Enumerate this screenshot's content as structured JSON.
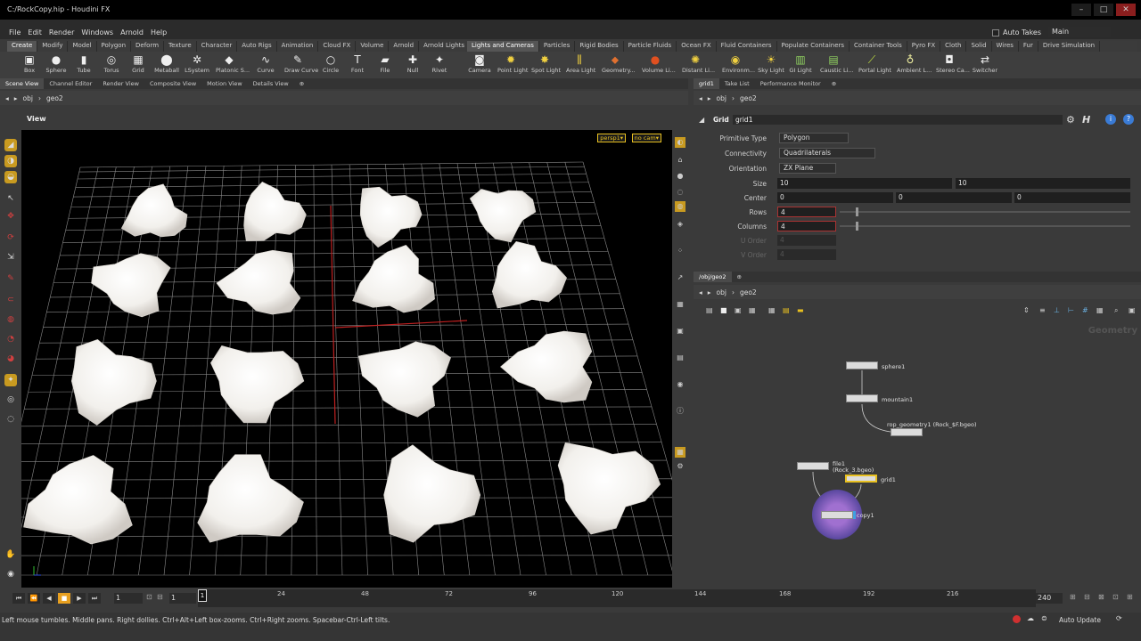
{
  "window": {
    "title": "C:/RockCopy.hip - Houdini FX",
    "buttons": [
      "–",
      "□",
      "✕"
    ]
  },
  "menubar": {
    "items": [
      "File",
      "Edit",
      "Render",
      "Windows",
      "Arnold",
      "Help"
    ],
    "auto_takes": "Auto Takes",
    "desktop": "Main"
  },
  "shelf_left_tabs": [
    "Create",
    "Modify",
    "Model",
    "Polygon",
    "Deform",
    "Texture",
    "Character",
    "Auto Rigs",
    "Animation",
    "Cloud FX",
    "Volume",
    "Arnold",
    "Arnold Lights"
  ],
  "shelf_right_tabs": [
    "Lights and Cameras",
    "Particles",
    "Rigid Bodies",
    "Particle Fluids",
    "Ocean FX",
    "Fluid Containers",
    "Populate Containers",
    "Container Tools",
    "Pyro FX",
    "Cloth",
    "Solid",
    "Wires",
    "Fur",
    "Drive Simulation"
  ],
  "shelf_left_tools": [
    "Box",
    "Sphere",
    "Tube",
    "Torus",
    "Grid",
    "Metaball",
    "LSystem",
    "Platonic S...",
    "Curve",
    "Draw Curve",
    "Circle",
    "Font",
    "File",
    "Null",
    "Rivet"
  ],
  "shelf_right_tools": [
    "Camera",
    "Point Light",
    "Spot Light",
    "Area Light",
    "Geometry...",
    "Volume Li...",
    "Distant Li...",
    "Environm...",
    "Sky Light",
    "GI Light",
    "Caustic Li...",
    "Portal Light",
    "Ambient L...",
    "Stereo Ca...",
    "Switcher"
  ],
  "left_pane": {
    "tabs": [
      "Scene View",
      "Channel Editor",
      "Render View",
      "Composite View",
      "Motion View",
      "Details View"
    ],
    "path": [
      "obj",
      "geo2"
    ],
    "view_label": "View",
    "persp": "persp1▾",
    "cam": "no cam▾"
  },
  "param_pane": {
    "tabs": [
      "grid1",
      "Take List",
      "Performance Monitor"
    ],
    "path": [
      "obj",
      "geo2"
    ],
    "node_type": "Grid",
    "node_name": "grid1",
    "primitive_type": {
      "label": "Primitive Type",
      "value": "Polygon"
    },
    "connectivity": {
      "label": "Connectivity",
      "value": "Quadrilaterals"
    },
    "orientation": {
      "label": "Orientation",
      "value": "ZX Plane"
    },
    "size": {
      "label": "Size",
      "x": "10",
      "y": "10"
    },
    "center": {
      "label": "Center",
      "x": "0",
      "y": "0",
      "z": "0"
    },
    "rows": {
      "label": "Rows",
      "value": "4"
    },
    "columns": {
      "label": "Columns",
      "value": "4"
    },
    "u_order": {
      "label": "U Order",
      "value": "4"
    },
    "v_order": {
      "label": "V Order",
      "value": "4"
    }
  },
  "network_pane": {
    "tab": "/obj/geo2",
    "path": [
      "obj",
      "geo2"
    ],
    "watermark": "Geometry",
    "nodes": {
      "sphere1": "sphere1",
      "mountain1": "mountain1",
      "rop": "rop_geometry1 (Rock_$F.bgeo)",
      "file1": "file1",
      "file1_sub": "(Rock_3.bgeo)",
      "grid1": "grid1",
      "copy1": "copy1"
    }
  },
  "timeline": {
    "start": "1",
    "frame": "1",
    "end": "240",
    "ticks": [
      "24",
      "48",
      "72",
      "96",
      "120",
      "144",
      "168",
      "192",
      "216"
    ],
    "current_marker": "1"
  },
  "status": {
    "text": "Left mouse tumbles. Middle pans. Right dollies. Ctrl+Alt+Left box-zooms. Ctrl+Right zooms. Spacebar-Ctrl-Left tilts.",
    "auto_update": "Auto Update"
  },
  "colors": {
    "accent_yellow": "#e8c020",
    "node_selected": "#e8c020",
    "copy_highlight": "#7a5fc0",
    "viewport_bg": "#000000"
  }
}
